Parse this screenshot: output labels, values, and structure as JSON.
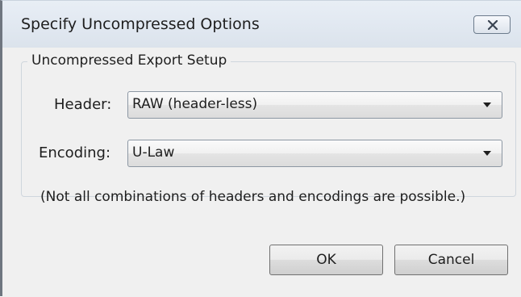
{
  "window": {
    "title": "Specify Uncompressed Options",
    "close_icon": "close-x-icon"
  },
  "group": {
    "legend": "Uncompressed Export Setup"
  },
  "header": {
    "label": "Header:",
    "selected": "RAW (header-less)"
  },
  "encoding": {
    "label": "Encoding:",
    "selected": "U-Law"
  },
  "note": "(Not all combinations of headers and encodings are possible.)",
  "buttons": {
    "ok": "OK",
    "cancel": "Cancel"
  },
  "colors": {
    "title_bar": "#dfe6ee",
    "dialog_background": "#f0f0f0"
  }
}
